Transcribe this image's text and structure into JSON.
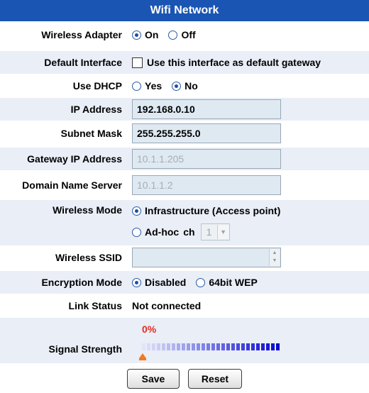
{
  "title": "Wifi Network",
  "wireless_adapter": {
    "label": "Wireless Adapter",
    "on": "On",
    "off": "Off",
    "selected": "On"
  },
  "default_interface": {
    "label": "Default Interface",
    "checkbox_label": "Use this interface as default gateway",
    "checked": false
  },
  "use_dhcp": {
    "label": "Use DHCP",
    "yes": "Yes",
    "no": "No",
    "selected": "No"
  },
  "ip_address": {
    "label": "IP Address",
    "value": "192.168.0.10"
  },
  "subnet_mask": {
    "label": "Subnet Mask",
    "value": "255.255.255.0"
  },
  "gateway_ip": {
    "label": "Gateway IP Address",
    "value": "10.1.1.205"
  },
  "dns": {
    "label": "Domain Name Server",
    "value": "10.1.1.2"
  },
  "wireless_mode": {
    "label": "Wireless Mode",
    "infrastructure": "Infrastructure (Access point)",
    "adhoc": "Ad-hoc",
    "ch_label": "ch",
    "channel": "1",
    "selected": "Infrastructure (Access point)"
  },
  "wireless_ssid": {
    "label": "Wireless SSID",
    "value": ""
  },
  "encryption_mode": {
    "label": "Encryption Mode",
    "disabled": "Disabled",
    "wep": "64bit WEP",
    "selected": "Disabled"
  },
  "link_status": {
    "label": "Link Status",
    "value": "Not connected"
  },
  "signal_strength": {
    "label": "Signal Strength",
    "percent_text": "0%",
    "level": 0
  },
  "buttons": {
    "save": "Save",
    "reset": "Reset"
  },
  "colors": {
    "header": "#1a55b4",
    "row_shade": "#e9eef7",
    "percent": "#e52b20",
    "marker": "#f07a20"
  }
}
